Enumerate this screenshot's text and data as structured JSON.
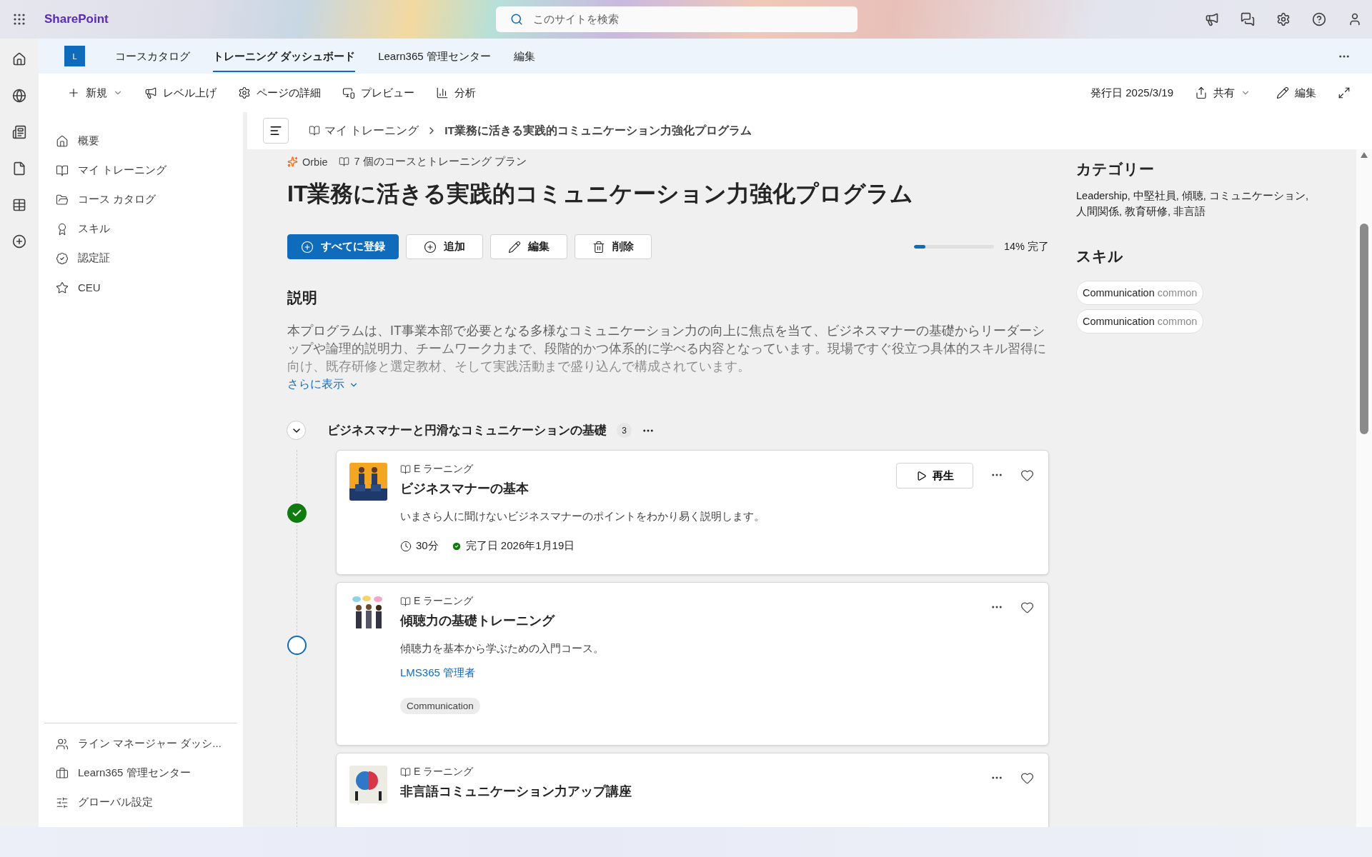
{
  "top_bar": {
    "app_name": "SharePoint",
    "search_placeholder": "このサイトを検索"
  },
  "site_nav": {
    "logo": "L",
    "tabs": [
      {
        "label": "コースカタログ",
        "selected": false
      },
      {
        "label": "トレーニング ダッシュボード",
        "selected": true
      },
      {
        "label": "Learn365 管理センター",
        "selected": false
      },
      {
        "label": "編集",
        "selected": false
      }
    ]
  },
  "toolbar": {
    "left": [
      {
        "label": "新規",
        "dropdown": true
      },
      {
        "label": "レベル上げ",
        "dropdown": false
      },
      {
        "label": "ページの詳細",
        "dropdown": false
      },
      {
        "label": "プレビュー",
        "dropdown": false
      },
      {
        "label": "分析",
        "dropdown": false
      }
    ],
    "published": "発行日 2025/3/19",
    "share": "共有",
    "edit": "編集"
  },
  "sidebar": {
    "items": [
      {
        "label": "概要"
      },
      {
        "label": "マイ トレーニング"
      },
      {
        "label": "コース カタログ"
      },
      {
        "label": "スキル"
      },
      {
        "label": "認定証"
      },
      {
        "label": "CEU"
      }
    ],
    "footer": [
      {
        "label": "ライン マネージャー ダッシ..."
      },
      {
        "label": "Learn365 管理センター"
      },
      {
        "label": "グローバル設定"
      }
    ]
  },
  "breadcrumb": [
    "マイ トレーニング",
    "IT業務に活きる実践的コミュニケーション力強化プログラム"
  ],
  "meta": {
    "author": "Orbie",
    "count": "7 個のコースとトレーニング プラン"
  },
  "title": "IT業務に活きる実践的コミュニケーション力強化プログラム",
  "actions": [
    {
      "label": "すべてに登録",
      "kind": "primary"
    },
    {
      "label": "追加",
      "kind": "add"
    },
    {
      "label": "編集",
      "kind": "edit"
    },
    {
      "label": "削除",
      "kind": "delete"
    }
  ],
  "progress": {
    "level": 0.14,
    "text": "14% 完了"
  },
  "description": {
    "heading": "説明",
    "text": "本プログラムは、IT事業本部で必要となる多様なコミュニケーション力の向上に焦点を当て、ビジネスマナーの基礎からリーダーシップや論理的説明力、チームワーク力まで、段階的かつ体系的に学べる内容となっています。現場ですぐ役立つ具体的スキル習得に向け、既存研修と選定教材、そして実践活動まで盛り込んで構成されています。",
    "show_more": "さらに表示"
  },
  "section": {
    "title": "ビジネスマナーと円滑なコミュニケーションの基礎",
    "count": "3",
    "expanded": true,
    "courses": [
      {
        "type": "E ラーニング",
        "title": "ビジネスマナーの基本",
        "completed": true,
        "play": "再生",
        "description": "いまさら人に聞けないビジネスマナーのポイントをわかり易く説明します。",
        "duration": "30分",
        "completed_text": "完了日 2026年1月19日"
      },
      {
        "type": "E ラーニング",
        "title": "傾聴力の基礎トレーニング",
        "completed": false,
        "description": "傾聴力を基本から学ぶための入門コース。",
        "author": "LMS365 管理者",
        "tags": [
          "Communication"
        ]
      },
      {
        "type": "E ラーニング",
        "title": "非言語コミュニケーション力アップ講座"
      }
    ]
  },
  "right_panel": {
    "categories_heading": "カテゴリー",
    "categories": "Leadership, 中堅社員, 傾聴, コミュニケーション, 人間関係, 教育研修, 非言語",
    "skills_heading": "スキル",
    "skills": [
      {
        "name": "Communication",
        "level": "common"
      },
      {
        "name": "Communication",
        "level": "common"
      }
    ]
  }
}
